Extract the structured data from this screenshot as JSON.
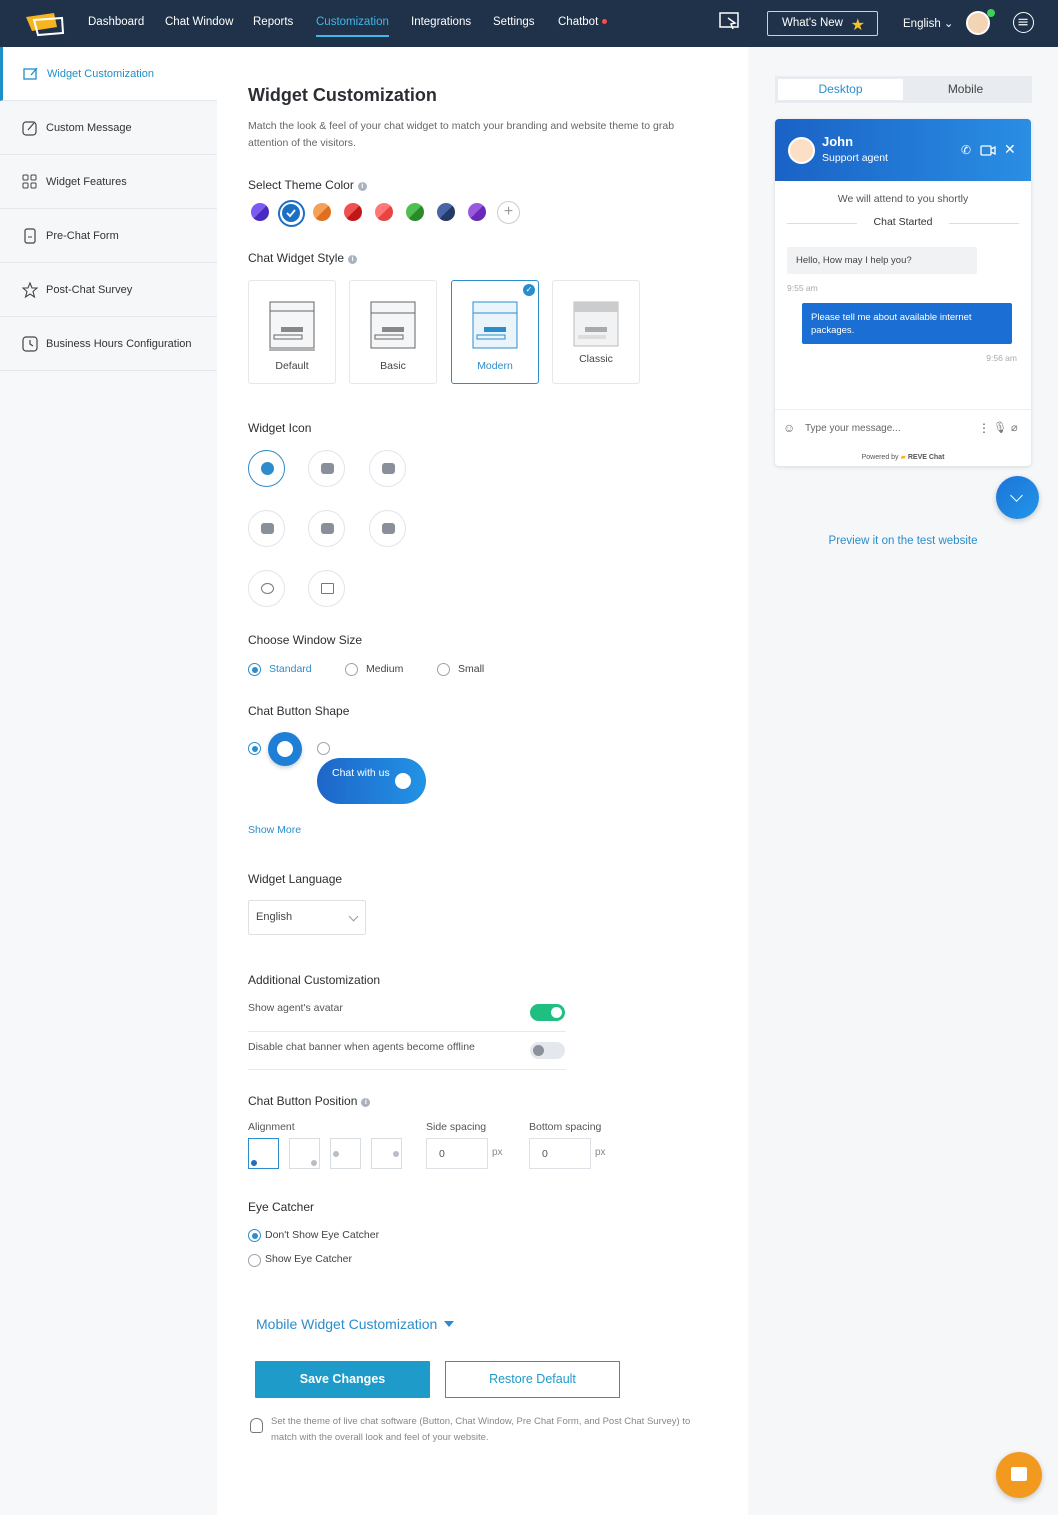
{
  "nav": {
    "items": [
      "Dashboard",
      "Chat Window",
      "Reports",
      "Customization",
      "Integrations",
      "Settings",
      "Chatbot"
    ],
    "active": "Customization",
    "whats_new": "What's New",
    "language": "English"
  },
  "sidebar": {
    "items": [
      {
        "label": "Widget Customization",
        "icon": "edit-screen-icon"
      },
      {
        "label": "Custom Message",
        "icon": "edit-icon"
      },
      {
        "label": "Widget Features",
        "icon": "grid-icon"
      },
      {
        "label": "Pre-Chat Form",
        "icon": "form-icon"
      },
      {
        "label": "Post-Chat Survey",
        "icon": "star-icon"
      },
      {
        "label": "Business Hours Configuration",
        "icon": "clock-icon"
      }
    ]
  },
  "main": {
    "title": "Widget Customization",
    "subtitle": "Match the look & feel of your chat widget to match your branding and website theme to grab attention of the visitors.",
    "theme_color_label": "Select Theme Color",
    "theme_colors": [
      "#5b3fd6",
      "#1d6fc4",
      "#f08a3c",
      "#e53935",
      "#f25b5b",
      "#3aa33a",
      "#34495e",
      "#7b3fc4"
    ],
    "widget_style_label": "Chat Widget Style",
    "widget_styles": [
      "Default",
      "Basic",
      "Modern",
      "Classic"
    ],
    "widget_icon_label": "Widget Icon",
    "window_size_label": "Choose Window Size",
    "window_sizes": [
      "Standard",
      "Medium",
      "Small"
    ],
    "button_shape_label": "Chat Button Shape",
    "chat_with_us": "Chat with us",
    "show_more": "Show More",
    "widget_language_label": "Widget Language",
    "widget_language_value": "English",
    "additional_label": "Additional Customization",
    "show_avatar": "Show agent's avatar",
    "disable_banner": "Disable chat banner when agents become offline",
    "position_label": "Chat Button Position",
    "alignment_label": "Alignment",
    "side_spacing_label": "Side spacing",
    "bottom_spacing_label": "Bottom spacing",
    "side_spacing_value": "0",
    "bottom_spacing_value": "0",
    "px": "px",
    "eye_catcher_label": "Eye Catcher",
    "eye_catcher_options": [
      "Don't Show Eye Catcher",
      "Show Eye Catcher"
    ],
    "mobile_customization": "Mobile Widget Customization",
    "save": "Save Changes",
    "restore": "Restore Default",
    "tip": "Set the theme of live chat software (Button, Chat Window, Pre Chat Form, and Post Chat Survey) to match with the overall look and feel of your website."
  },
  "preview": {
    "tabs": [
      "Desktop",
      "Mobile"
    ],
    "agent_name": "John",
    "agent_role": "Support agent",
    "attend": "We will attend to you shortly",
    "chat_started": "Chat Started",
    "msg_in": "Hello, How may I help you?",
    "msg_in_time": "9:55 am",
    "msg_out": "Please tell me about available internet packages.",
    "msg_out_time": "9:56 am",
    "input_placeholder": "Type your message...",
    "powered_by": "Powered by",
    "brand": "REVE Chat",
    "preview_link": "Preview it on the test website"
  }
}
